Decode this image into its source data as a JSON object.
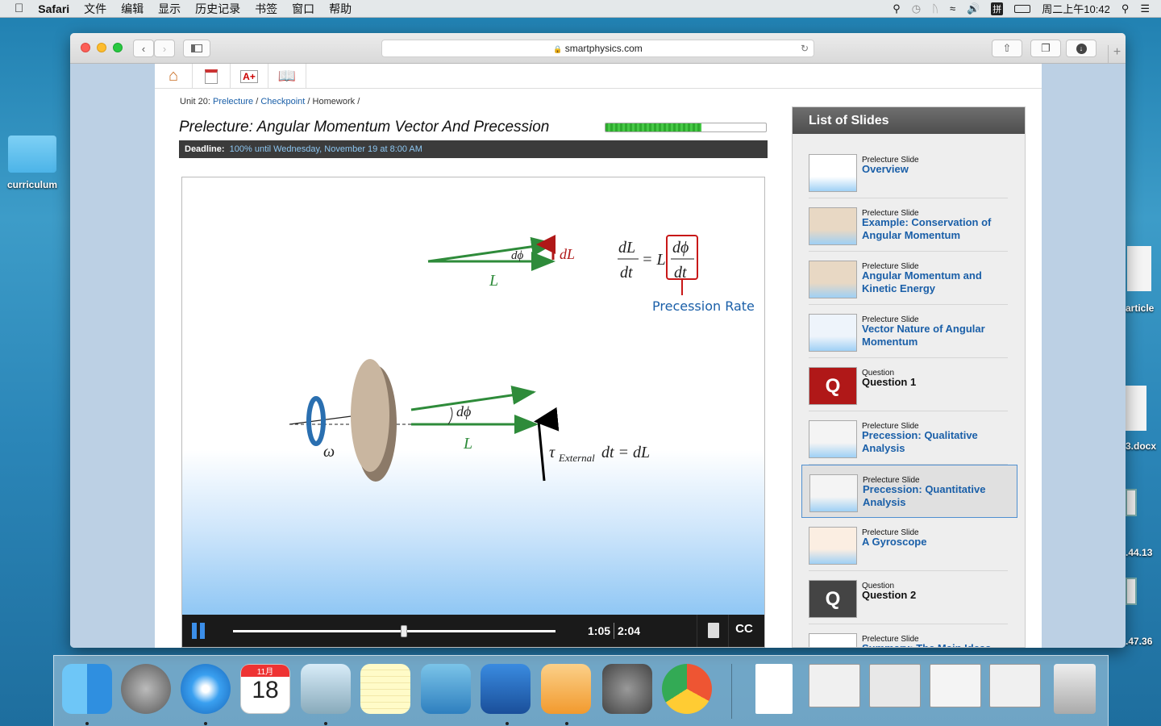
{
  "menubar": {
    "app": "Safari",
    "items": [
      "文件",
      "编辑",
      "显示",
      "历史记录",
      "书签",
      "窗口",
      "帮助"
    ],
    "clock": "周二上午10:42"
  },
  "desktop": {
    "folder_label": "curriculum",
    "right_labels": [
      "article",
      "3.docx",
      ".44.13",
      ".47.36"
    ]
  },
  "browser": {
    "url": "smartphysics.com"
  },
  "page": {
    "breadcrumb": {
      "prefix": "Unit 20:",
      "link1": "Prelecture",
      "link2": "Checkpoint",
      "current": "Homework",
      "sep": "/"
    },
    "title": "Prelecture: Angular Momentum Vector And Precession",
    "progress_fraction": 0.6,
    "deadline_label": "Deadline:",
    "deadline_value": "100% until Wednesday, November 19 at 8:00 AM"
  },
  "slide": {
    "precession_label": "Precession Rate",
    "top_dphi": "dϕ",
    "top_dL": "dL",
    "top_L": "L",
    "eq_num": "dL",
    "eq_den": "dt",
    "eq_mid": "= L",
    "eq_box_num": "dϕ",
    "eq_box_den": "dt",
    "bottom_dphi": "dϕ",
    "bottom_L": "L",
    "omega": "ω",
    "torque_tau": "τ",
    "torque_sub": "External",
    "torque_rest": "dt = dL"
  },
  "player": {
    "current_time": "1:05",
    "duration": "2:04",
    "progress_fraction": 0.52,
    "cc_label": "CC"
  },
  "sidebar": {
    "title": "List of Slides",
    "items": [
      {
        "type": "Prelecture Slide",
        "title": "Overview"
      },
      {
        "type": "Prelecture Slide",
        "title": "Example: Conservation of Angular Momentum"
      },
      {
        "type": "Prelecture Slide",
        "title": "Angular Momentum and Kinetic Energy"
      },
      {
        "type": "Prelecture Slide",
        "title": "Vector Nature of Angular Momentum"
      },
      {
        "type": "Question",
        "title": "Question 1"
      },
      {
        "type": "Prelecture Slide",
        "title": "Precession: Qualitative Analysis"
      },
      {
        "type": "Prelecture Slide",
        "title": "Precession: Quantitative Analysis"
      },
      {
        "type": "Prelecture Slide",
        "title": "A Gyroscope"
      },
      {
        "type": "Question",
        "title": "Question 2"
      },
      {
        "type": "Prelecture Slide",
        "title": "Summary: The Main Ideas"
      }
    ],
    "selected_index": 6
  },
  "dock": {
    "calendar_month": "11月",
    "calendar_day": "18"
  }
}
